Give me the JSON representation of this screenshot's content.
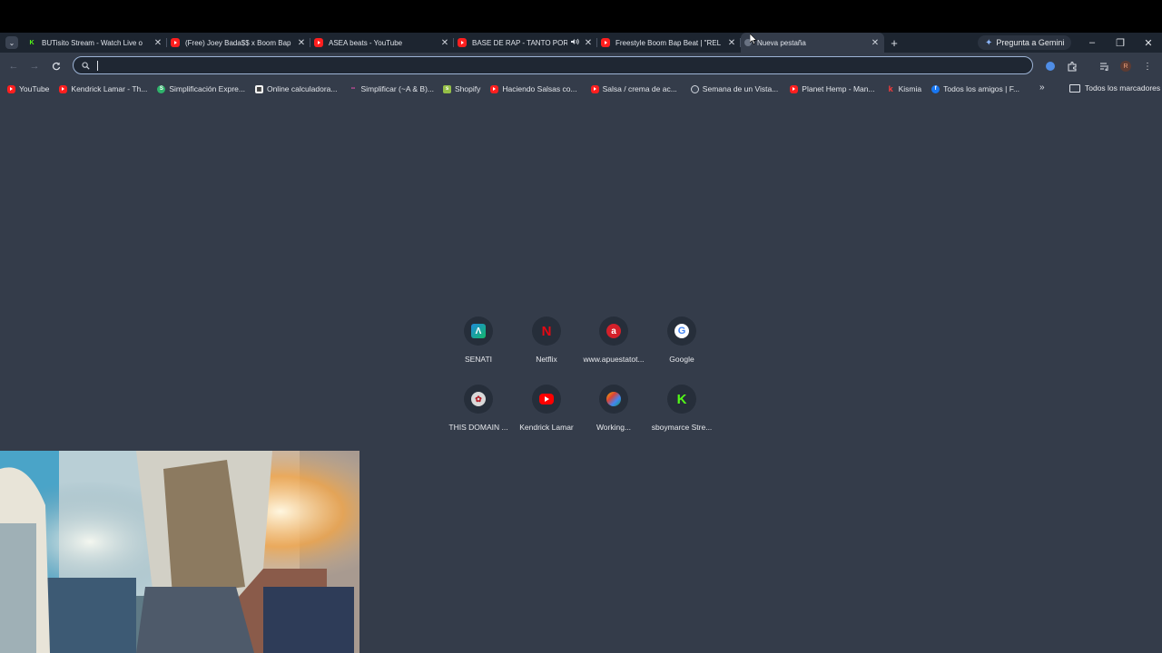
{
  "tabs": [
    {
      "title": "BUTisito Stream - Watch Live o",
      "favicon": "kick-icon",
      "active": false,
      "audio": false
    },
    {
      "title": "(Free) Joey Bada$$ x Boom Bap",
      "favicon": "youtube-icon",
      "active": false,
      "audio": false
    },
    {
      "title": "ASEA beats - YouTube",
      "favicon": "youtube-icon",
      "active": false,
      "audio": false
    },
    {
      "title": "BASE DE RAP - TANTO POR",
      "favicon": "youtube-icon",
      "active": false,
      "audio": true
    },
    {
      "title": "Freestyle Boom Bap Beat | \"REL",
      "favicon": "youtube-icon",
      "active": false,
      "audio": false
    },
    {
      "title": "Nueva pestaña",
      "favicon": "new-tab-icon",
      "active": true,
      "audio": false
    }
  ],
  "gemini_label": "Pregunta a Gemini",
  "omnibox": {
    "value": "",
    "placeholder": ""
  },
  "bookmarks": [
    {
      "label": "YouTube",
      "icon": "youtube-icon"
    },
    {
      "label": "Kendrick Lamar - Th...",
      "icon": "youtube-icon"
    },
    {
      "label": "Simplificación Expre...",
      "icon": "symbolab-icon"
    },
    {
      "label": "Online calculadora...",
      "icon": "calculator-icon"
    },
    {
      "label": "Simplificar (~A & B)...",
      "icon": "dots-icon"
    },
    {
      "label": "Shopify",
      "icon": "shopify-icon"
    },
    {
      "label": "Haciendo Salsas co...",
      "icon": "youtube-icon"
    },
    {
      "label": "Salsa / crema de ac...",
      "icon": "youtube-icon"
    },
    {
      "label": "Semana de un Vista...",
      "icon": "globe-icon"
    },
    {
      "label": "Planet Hemp - Man...",
      "icon": "youtube-icon"
    },
    {
      "label": "Kismia",
      "icon": "kismia-icon"
    },
    {
      "label": "Todos los amigos | F...",
      "icon": "facebook-icon"
    }
  ],
  "all_bookmarks_label": "Todos los marcadores",
  "shortcuts": [
    {
      "label": "SENATI",
      "icon": "senati-icon"
    },
    {
      "label": "Netflix",
      "icon": "netflix-icon"
    },
    {
      "label": "www.apuestatot...",
      "icon": "apuesta-total-icon"
    },
    {
      "label": "Google",
      "icon": "google-icon"
    },
    {
      "label": "THIS DOMAIN ...",
      "icon": "domain-icon"
    },
    {
      "label": "Kendrick Lamar",
      "icon": "youtube-icon"
    },
    {
      "label": "Working...",
      "icon": "working-icon"
    },
    {
      "label": "sboymarce Stre...",
      "icon": "kick-icon"
    }
  ],
  "colors": {
    "background": "#343c4a",
    "tabstrip": "#1d2530",
    "omnibox_border": "#9db4d6",
    "youtube_red": "#ff1f1f",
    "kick_green": "#53fc18"
  }
}
